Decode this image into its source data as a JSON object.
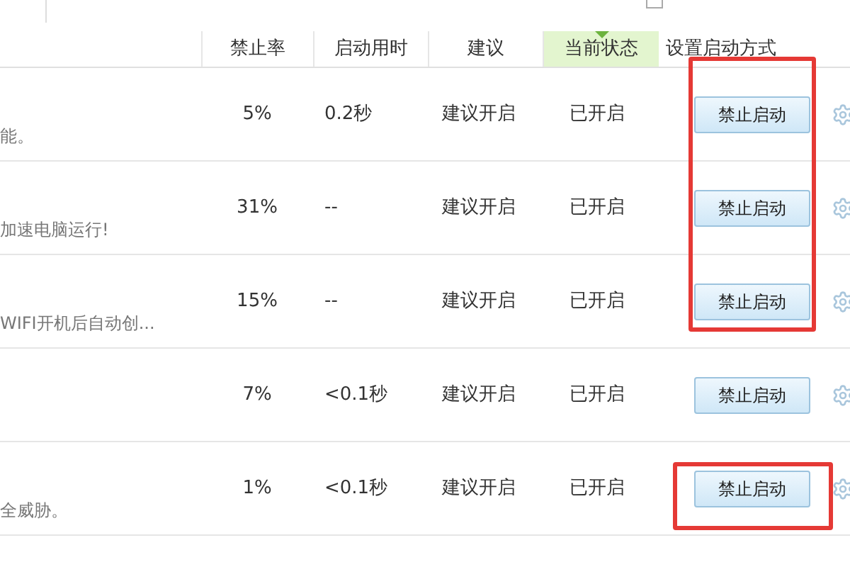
{
  "top_checkbox": {
    "checked": false
  },
  "columns": [
    "禁止率",
    "启动用时",
    "建议",
    "当前状态",
    "设置启动方式"
  ],
  "sorted_column_index_selected": [
    false,
    false,
    false,
    true,
    false
  ],
  "rows": [
    {
      "description": "能。",
      "ban_rate": "5%",
      "boot_time": "0.2秒",
      "advice": "建议开启",
      "status": "已开启",
      "action": "禁止启动",
      "marked": true
    },
    {
      "description": "加速电脑运行!",
      "ban_rate": "31%",
      "boot_time": "--",
      "advice": "建议开启",
      "status": "已开启",
      "action": "禁止启动",
      "marked": true
    },
    {
      "description": "WIFI开机后自动创...",
      "ban_rate": "15%",
      "boot_time": "--",
      "advice": "建议开启",
      "status": "已开启",
      "action": "禁止启动",
      "marked": true
    },
    {
      "ban_rate": "7%",
      "boot_time": "<0.1秒",
      "advice": "建议开启",
      "status": "已开启",
      "action": "禁止启动",
      "marked": false
    },
    {
      "description": "全威胁。",
      "ban_rate": "1%",
      "boot_time": "<0.1秒",
      "advice": "建议开启",
      "status": "已开启",
      "action": "禁止启动",
      "marked": true
    }
  ]
}
